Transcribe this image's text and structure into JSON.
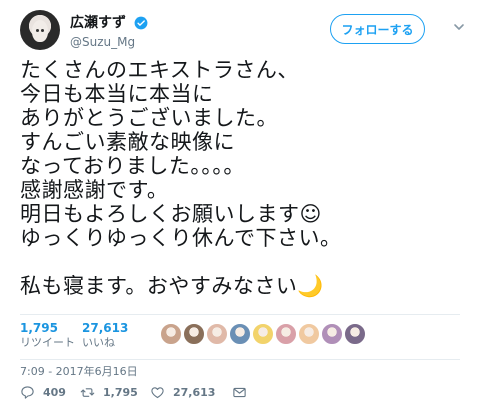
{
  "user": {
    "display_name": "広瀬すず",
    "handle": "@Suzu_Mg",
    "verified": true
  },
  "follow_label": "フォローする",
  "tweet_text": "たくさんのエキストラさん、\n今日も本当に本当に\nありがとうございました。\nすんごい素敵な映像に\nなっておりました。。。。\n感謝感謝です。\n明日もよろしくお願いします☺\nゆっくりゆっくり休んで下さい。\n\n私も寝ます。おやすみなさい🌙",
  "stats": {
    "retweets": {
      "count": "1,795",
      "label": "リツイート"
    },
    "likes": {
      "count": "27,613",
      "label": "いいね"
    }
  },
  "likers": [
    {
      "color": "#c9a38c"
    },
    {
      "color": "#8a6f5a"
    },
    {
      "color": "#e0b9a8"
    },
    {
      "color": "#6a8fb5"
    },
    {
      "color": "#f2d36b"
    },
    {
      "color": "#d9a0a8"
    },
    {
      "color": "#f0c9a0"
    },
    {
      "color": "#b08fb8"
    },
    {
      "color": "#7a6a8a"
    }
  ],
  "timestamp": "7:09 - 2017年6月16日",
  "actions": {
    "reply_count": "409",
    "retweet_count": "1,795",
    "like_count": "27,613"
  },
  "colors": {
    "accent": "#1da1f2",
    "text": "#14171a",
    "muted": "#657786"
  }
}
